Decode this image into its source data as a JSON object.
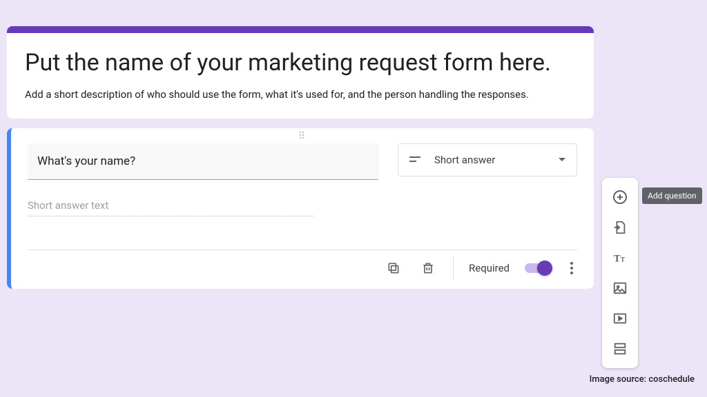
{
  "form": {
    "title": "Put the name of your marketing request form here.",
    "description": "Add a short description of who should use the form, what it's used for, and the person handling the responses."
  },
  "question": {
    "title": "What's your name?",
    "type_label": "Short answer",
    "answer_placeholder": "Short answer text",
    "required_label": "Required",
    "required_on": true
  },
  "toolbar": {
    "tooltip_add": "Add question"
  },
  "credit": "Image source: coschedule"
}
